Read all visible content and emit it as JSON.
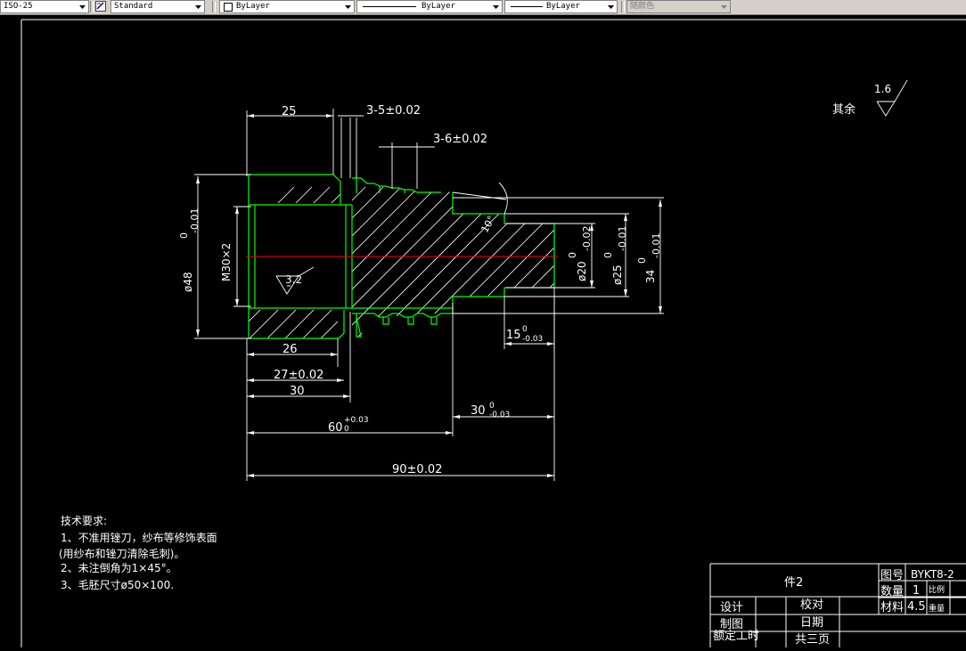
{
  "toolbar": {
    "dim_style": "ISO-25",
    "text_style": "Standard",
    "layer": "ByLayer",
    "linetype": "ByLayer",
    "lineweight": "ByLayer",
    "plot_style": "随颜色"
  },
  "drawing": {
    "roughness_rest_label": "其余",
    "roughness_rest_value": "1.6",
    "roughness_bore_value": "3.2",
    "thread_label": "M30×2",
    "dims": {
      "d25_top": "25",
      "d3_5": "3-5±0.02",
      "d3_6": "3-6±0.02",
      "angle": "10°",
      "dia48": "ø48",
      "dia48_tol_upper": "0",
      "dia48_tol_lower": "-0.01",
      "dia20": "ø20",
      "dia20_tol_upper": "0",
      "dia20_tol_lower": "-0.02",
      "dia25": "ø25",
      "dia25_tol_upper": "0",
      "dia25_tol_lower": "-0.01",
      "dia34": "34",
      "dia34_tol_upper": "0",
      "dia34_tol_lower": "-0.01",
      "len15": "15",
      "len15_tol_upper": "0",
      "len15_tol_lower": "-0.03",
      "len26": "26",
      "len27": "27±0.02",
      "len30": "30",
      "len30b": "30",
      "len30b_tol_upper": "0",
      "len30b_tol_lower": "-0.03",
      "len60": "60",
      "len60_tol_upper": "+0.03",
      "len60_tol_lower": "0",
      "len90": "90±0.02"
    },
    "notes": {
      "title": "技术要求:",
      "line1": "1、不准用锉刀，纱布等修饰表面",
      "line2": "(用纱布和锉刀清除毛刺)。",
      "line3": "2、未注倒角为1×45°。",
      "line4": "3、毛胚尺寸ø50×100."
    },
    "title_block": {
      "part_name": "件2",
      "drawing_no_label": "图号",
      "drawing_no": "BYKT8-2",
      "qty_label": "数量",
      "qty": "1",
      "scale_label": "比例",
      "material_label": "材料",
      "material": "4.5",
      "weight_label": "重量",
      "design_label": "设计",
      "check_label": "校对",
      "draw_label": "制图",
      "date_label": "日期",
      "hours_label": "额定工时",
      "pages_label": "共三页"
    }
  },
  "colors": {
    "outline": "#00ff00",
    "dimension": "#ffffff",
    "centerline": "#ff0000",
    "toolbar_bg": "#d4d0c8"
  }
}
